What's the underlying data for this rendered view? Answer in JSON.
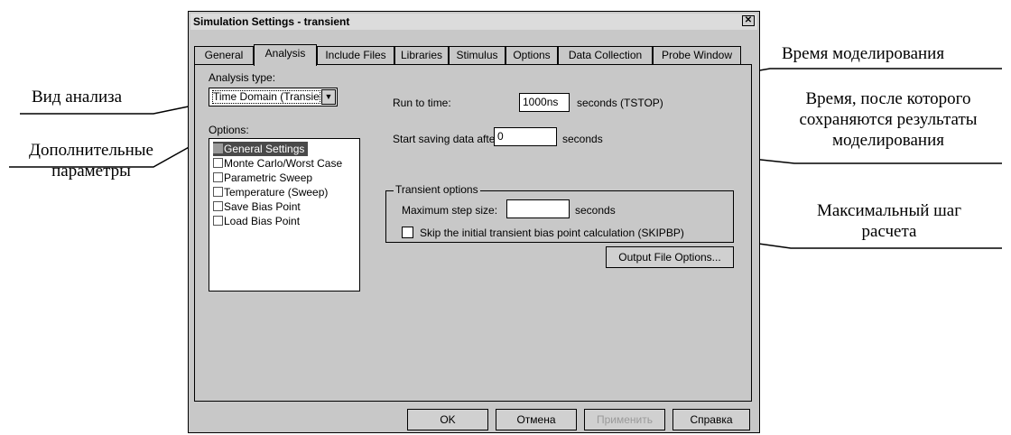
{
  "callouts": {
    "analysis_type": "Вид анализа",
    "options_line1": "Дополнительные",
    "options_line2": "параметры",
    "run_time": "Время моделирования",
    "save_line1": "Время, после которого",
    "save_line2": "сохраняются  результаты",
    "save_line3": "моделирования",
    "step_line1": "Максимальный шаг",
    "step_line2": "расчета"
  },
  "dialog": {
    "title": "Simulation Settings - transient",
    "close_glyph": "✕",
    "tabs": [
      "General",
      "Analysis",
      "Include Files",
      "Libraries",
      "Stimulus",
      "Options",
      "Data Collection",
      "Probe Window"
    ],
    "active_tab": "Analysis",
    "analysis_type_label": "Analysis type:",
    "analysis_type_value": "Time Domain (Transient)",
    "options_label": "Options:",
    "options": [
      {
        "label": "General Settings",
        "checked": true,
        "selected": true
      },
      {
        "label": "Monte Carlo/Worst Case",
        "checked": false
      },
      {
        "label": "Parametric Sweep",
        "checked": false
      },
      {
        "label": "Temperature (Sweep)",
        "checked": false
      },
      {
        "label": "Save Bias Point",
        "checked": false
      },
      {
        "label": "Load Bias Point",
        "checked": false
      }
    ],
    "run_to_time_label": "Run to time:",
    "run_to_time_value": "1000ns",
    "run_to_time_unit": "seconds  (TSTOP)",
    "start_saving_label": "Start saving data after:",
    "start_saving_value": "0",
    "start_saving_unit": "seconds",
    "transient_group": "Transient options",
    "max_step_label": "Maximum step size:",
    "max_step_value": "",
    "max_step_unit": "seconds",
    "skip_bias_label": "Skip the initial transient bias point calculation  (SKIPBP)",
    "skip_bias_checked": false,
    "output_file_button": "Output File Options...",
    "buttons": {
      "ok": "OK",
      "cancel": "Отмена",
      "apply": "Применить",
      "help": "Справка"
    }
  }
}
